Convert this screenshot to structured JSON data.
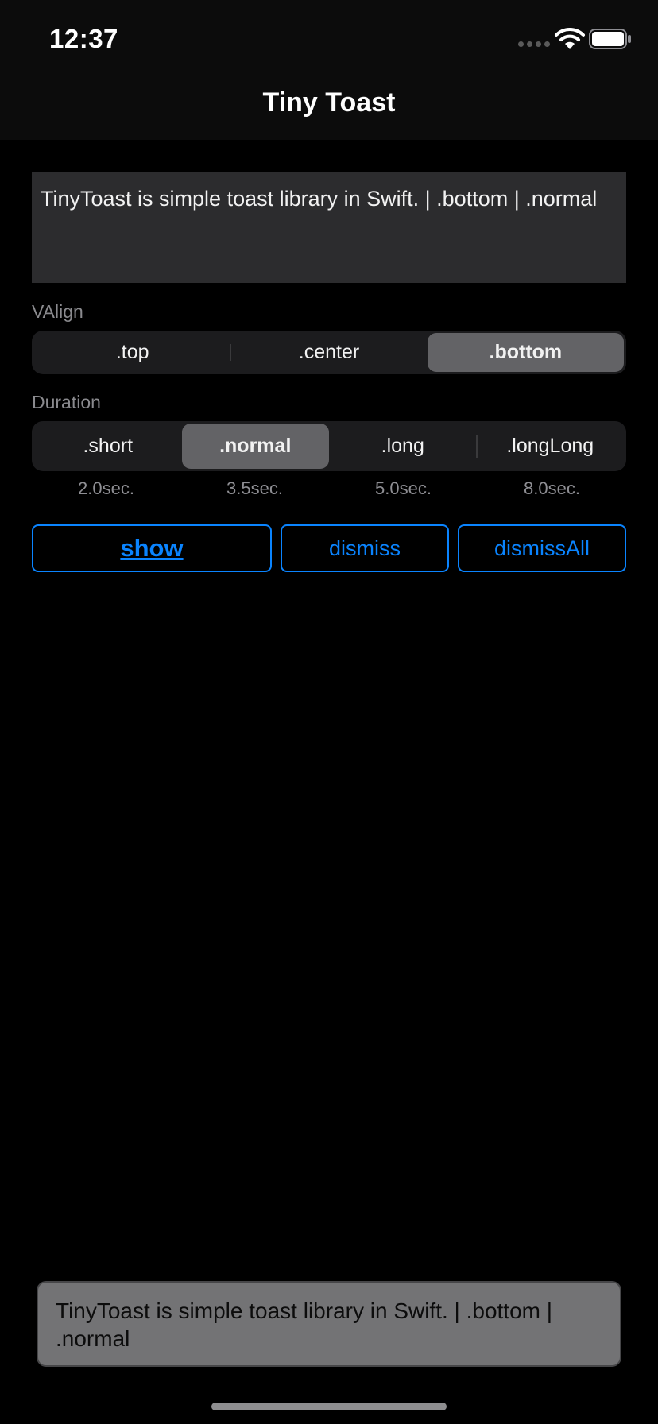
{
  "status_bar": {
    "time": "12:37"
  },
  "nav": {
    "title": "Tiny Toast"
  },
  "message_field": {
    "text": "TinyToast is simple toast library in Swift. | .bottom | .normal"
  },
  "valign": {
    "label": "VAlign",
    "segments": [
      ".top",
      ".center",
      ".bottom"
    ],
    "selected": ".bottom"
  },
  "duration": {
    "label": "Duration",
    "segments": [
      ".short",
      ".normal",
      ".long",
      ".longLong"
    ],
    "selected": ".normal",
    "seconds": [
      "2.0sec.",
      "3.5sec.",
      "5.0sec.",
      "8.0sec."
    ]
  },
  "buttons": {
    "show": "show",
    "dismiss": "dismiss",
    "dismiss_all": "dismissAll"
  },
  "toast": {
    "text": "TinyToast is simple toast library in Swift. | .bottom | .normal"
  },
  "colors": {
    "accent": "#0a84ff",
    "field_bg": "#2c2c2e",
    "segment_selected": "#636366",
    "toast_bg": "#737375"
  },
  "icons": [
    "cellular-signal-icon",
    "wifi-icon",
    "battery-icon"
  ]
}
